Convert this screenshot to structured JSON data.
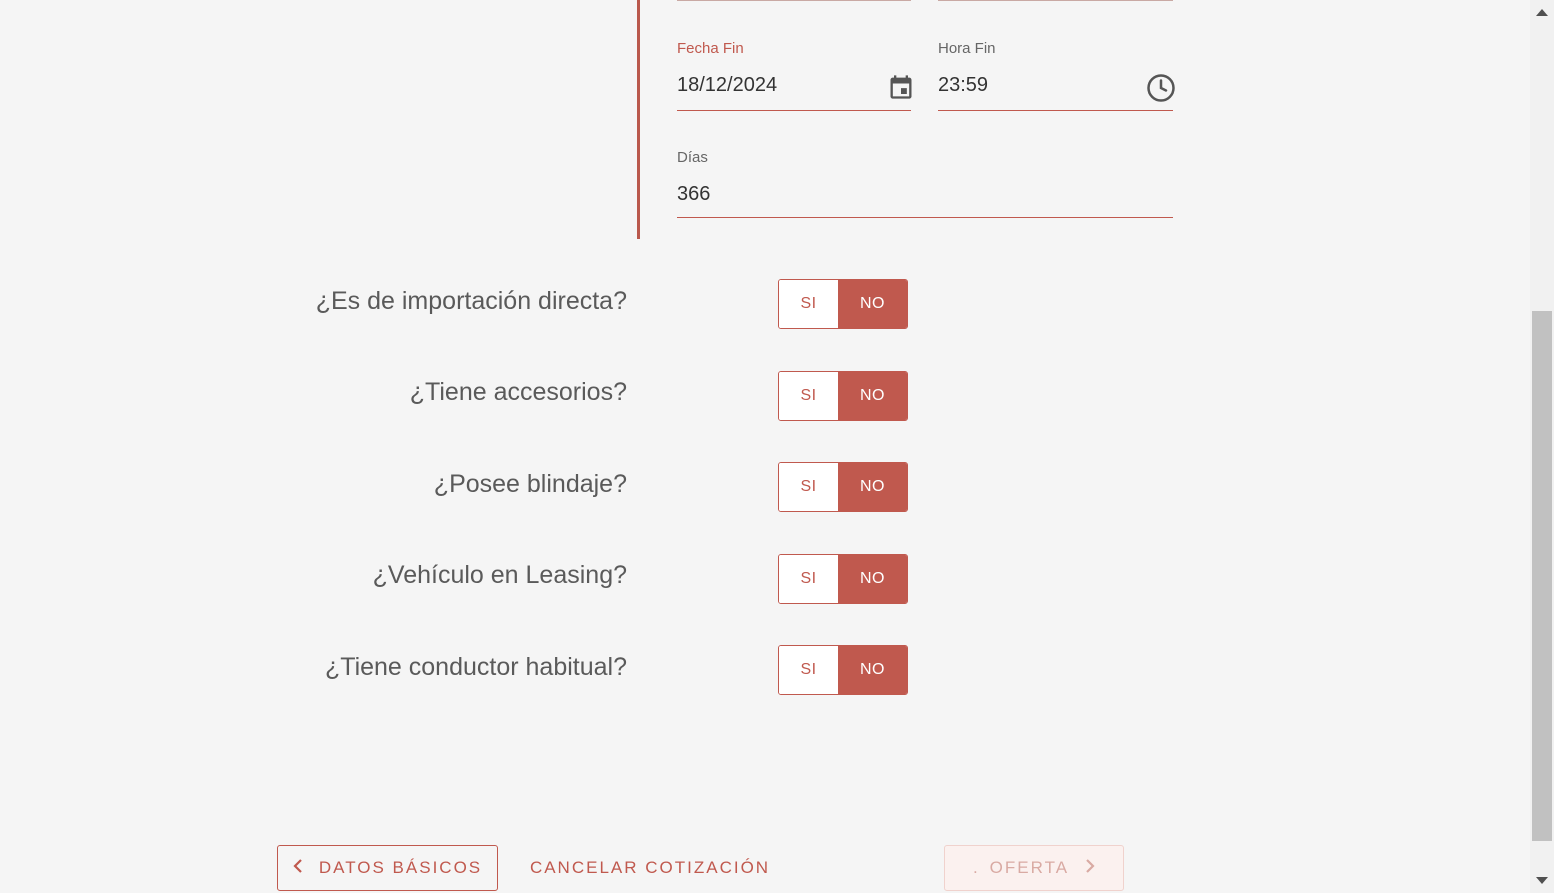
{
  "dates": {
    "fecha_fin": {
      "label": "Fecha Fin",
      "value": "18/12/2024",
      "icon": "calendar-icon"
    },
    "hora_fin": {
      "label": "Hora Fin",
      "value": "23:59",
      "icon": "clock-icon"
    },
    "dias": {
      "label": "Días",
      "value": "366"
    }
  },
  "questions": [
    {
      "label": "¿Es de importación directa?",
      "yes": "SI",
      "no": "NO",
      "selected": "NO"
    },
    {
      "label": "¿Tiene accesorios?",
      "yes": "SI",
      "no": "NO",
      "selected": "NO"
    },
    {
      "label": "¿Posee blindaje?",
      "yes": "SI",
      "no": "NO",
      "selected": "NO"
    },
    {
      "label": "¿Vehículo en Leasing?",
      "yes": "SI",
      "no": "NO",
      "selected": "NO"
    },
    {
      "label": "¿Tiene conductor habitual?",
      "yes": "SI",
      "no": "NO",
      "selected": "NO"
    }
  ],
  "footer": {
    "back_label": "DATOS BÁSICOS",
    "cancel_label": "CANCELAR COTIZACIÓN",
    "next_label": "OFERTA",
    "next_prefix": "."
  },
  "colors": {
    "accent": "#c0594e",
    "background": "#f5f5f5"
  }
}
